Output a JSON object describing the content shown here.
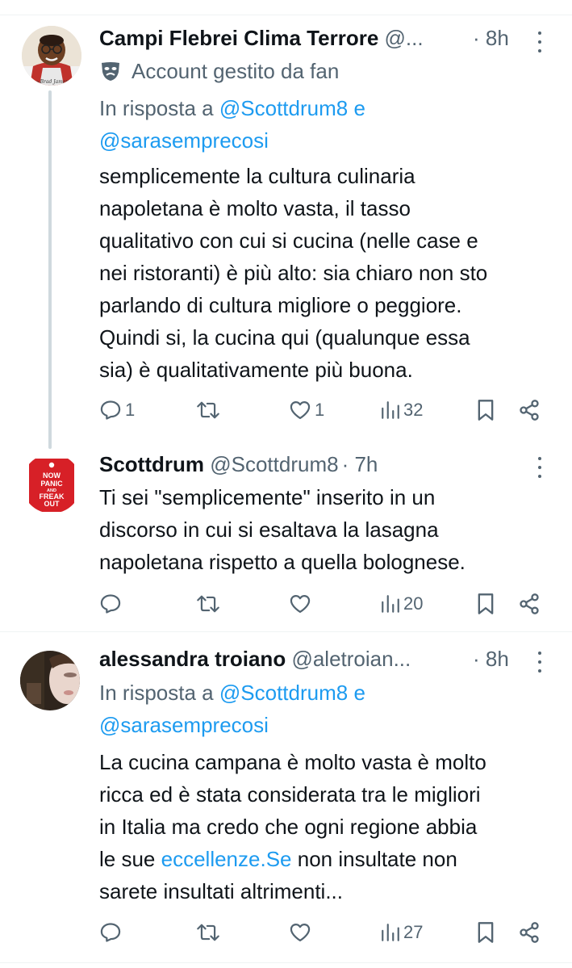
{
  "tweets": [
    {
      "name": "Campi Flebrei Clima Terrore",
      "handle": "@...",
      "time": "· 8h",
      "fan_label": "Account gestito da fan",
      "reply_prefix": "In risposta a",
      "reply_to_1": "@Scottdrum8",
      "reply_and": "e",
      "reply_to_2": "@sarasemprecosi",
      "text_lines": [
        "semplicemente la cultura culinaria",
        "napoletana è molto vasta, il tasso",
        "qualitativo con cui si cucina (nelle case e",
        "nei ristoranti) è più alto: sia chiaro non sto",
        "parlando di cultura migliore o peggiore.",
        "Quindi si, la cucina qui (qualunque essa",
        "sia) è qualitativamente più buona."
      ],
      "replies": "1",
      "retweets": "",
      "likes": "1",
      "views": "32"
    },
    {
      "name": "Scottdrum",
      "handle": "@Scottdrum8",
      "time": "· 7h",
      "avatar_text": [
        "NOW",
        "PANIC",
        "AND",
        "FREAK",
        "OUT"
      ],
      "text_lines": [
        "Ti sei \"semplicemente\" inserito in un",
        "discorso in cui si esaltava la lasagna",
        "napoletana rispetto a quella bolognese."
      ],
      "replies": "",
      "retweets": "",
      "likes": "",
      "views": "20"
    },
    {
      "name": "alessandra troiano",
      "handle": "@aletroian...",
      "time": "· 8h",
      "reply_prefix": "In risposta a",
      "reply_to_1": "@Scottdrum8",
      "reply_and": "e",
      "reply_to_2": "@sarasemprecosi",
      "text_lines": [
        "La cucina campana è molto vasta è molto",
        "ricca ed è stata considerata tra le migliori",
        "in Italia ma credo che ogni regione abbia"
      ],
      "text_line4_pre": "le sue",
      "text_line4_link": "eccellenze.Se",
      "text_line4_post": "non insultate non",
      "text_line5": "sarete insultati altrimenti...",
      "replies": "",
      "retweets": "",
      "likes": "",
      "views": "27"
    }
  ],
  "colors": {
    "text": "#0f1419",
    "secondary": "#536471",
    "link": "#1d9bf0",
    "divider": "#eff3f4",
    "thread_line": "#cfd9de",
    "scott_avatar": "#d72027"
  },
  "icons": [
    "reply-icon",
    "retweet-icon",
    "like-icon",
    "views-icon",
    "bookmark-icon",
    "share-icon",
    "more-icon",
    "fan-mask-icon"
  ]
}
